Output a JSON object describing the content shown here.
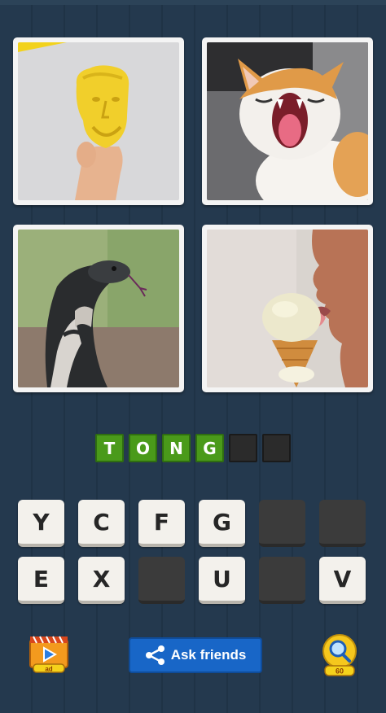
{
  "game": {
    "tiles": [
      {
        "name": "tile-yellow-head",
        "subject": "hand holding yellow sculpted head"
      },
      {
        "name": "tile-yawning-cat",
        "subject": "yawning cat showing tongue"
      },
      {
        "name": "tile-cobra",
        "subject": "cobra flicking tongue"
      },
      {
        "name": "tile-ice-cream",
        "subject": "person licking ice cream cone"
      }
    ],
    "answer": {
      "slots": [
        "T",
        "O",
        "N",
        "G",
        "",
        ""
      ],
      "filled_color": "#4a9a1a",
      "empty_color": "#2b2b2b"
    },
    "keys": [
      {
        "letter": "Y",
        "used": false
      },
      {
        "letter": "C",
        "used": false
      },
      {
        "letter": "F",
        "used": false
      },
      {
        "letter": "G",
        "used": false
      },
      {
        "letter": "",
        "used": true
      },
      {
        "letter": "",
        "used": true
      },
      {
        "letter": "E",
        "used": false
      },
      {
        "letter": "X",
        "used": false
      },
      {
        "letter": "",
        "used": true
      },
      {
        "letter": "U",
        "used": false
      },
      {
        "letter": "",
        "used": true
      },
      {
        "letter": "V",
        "used": false
      }
    ]
  },
  "bottom_bar": {
    "video_button": {
      "icon": "video-reward-icon",
      "badge": "ad"
    },
    "ask_button": {
      "label": "Ask friends",
      "icon": "share-icon",
      "color": "#1866c7"
    },
    "hint_button": {
      "icon": "magnifier-hint-icon",
      "cost": "60"
    }
  }
}
